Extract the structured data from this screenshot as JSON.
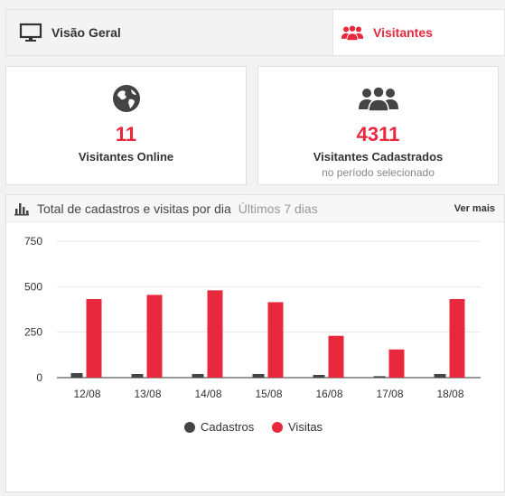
{
  "tabs": [
    {
      "label": "Visão Geral",
      "icon": "monitor-icon",
      "active": false
    },
    {
      "label": "Visitantes",
      "icon": "users-group-icon",
      "active": true
    }
  ],
  "cards": {
    "online": {
      "icon": "globe-icon",
      "value": "11",
      "label": "Visitantes Online"
    },
    "registered": {
      "icon": "users-group-icon",
      "value": "4311",
      "label": "Visitantes Cadastrados",
      "sub": "no período selecionado"
    }
  },
  "panel": {
    "title": "Total de cadastros e visitas por dia",
    "range": "Últimos 7 dias",
    "more_label": "Ver mais"
  },
  "colors": {
    "accent": "#e8283d",
    "dark": "#444444"
  },
  "chart_data": {
    "type": "bar",
    "categories": [
      "12/08",
      "13/08",
      "14/08",
      "15/08",
      "16/08",
      "17/08",
      "18/08"
    ],
    "series": [
      {
        "name": "Cadastros",
        "values": [
          25,
          20,
          20,
          20,
          15,
          8,
          20
        ],
        "color": "#444444"
      },
      {
        "name": "Visitas",
        "values": [
          432,
          455,
          480,
          415,
          230,
          155,
          432
        ],
        "color": "#e8283d"
      }
    ],
    "yticks": [
      0,
      250,
      500,
      750
    ],
    "ylim": [
      0,
      750
    ],
    "grid": true,
    "legend": "bottom"
  }
}
